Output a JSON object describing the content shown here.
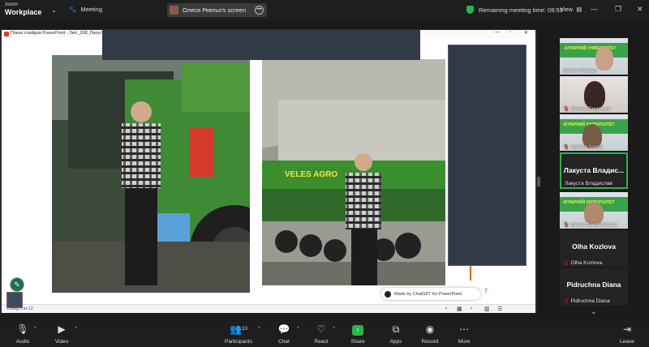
{
  "topbar": {
    "brand_line1": "zoom",
    "brand_line2": "Workplace",
    "meeting_label": "Meeting",
    "share_label": "Олеся Ревтьо's screen",
    "remaining": "Remaining meeting time: 09:53",
    "view_label": "View"
  },
  "ppt": {
    "title": "Показ слайдов PowerPoint - Звіт_208_Лакуста В...",
    "made_with": "Made by ChatGPT for PowerPoint",
    "page_number": "7",
    "status_left": "Слайд 1 из 12"
  },
  "gallery": [
    {
      "name": "Олеся Ревтьо",
      "muted": false,
      "video": true
    },
    {
      "name": "Олена Сидякіна",
      "muted": true,
      "video": true
    },
    {
      "name": "Mykola Ivaniv",
      "muted": true,
      "video": true
    },
    {
      "name": "Лакуста Владислав",
      "big": "Лакуста Владис...",
      "muted": false,
      "video": false,
      "active": true
    },
    {
      "name": "Ірина Соколовська",
      "muted": true,
      "video": true
    },
    {
      "name": "Olha Kozlova",
      "big": "Olha Kozlova",
      "muted": true,
      "video": false
    },
    {
      "name": "Pidruchna Diana",
      "big": "Pidruchna Diana",
      "muted": true,
      "video": false
    }
  ],
  "toolbar": {
    "audio": "Audio",
    "video": "Video",
    "participants": "Participants",
    "participants_count": "10",
    "chat": "Chat",
    "react": "React",
    "share": "Share",
    "apps": "Apps",
    "record": "Record",
    "more": "More",
    "leave": "Leave"
  },
  "colors": {
    "accent_green": "#2fb24c",
    "muted_red": "#e02929",
    "slide_orange": "#e06a20"
  },
  "icons": [
    "chevron-down-icon",
    "meeting-icon",
    "more-icon",
    "shield-icon",
    "minimize-icon",
    "maximize-icon",
    "close-icon",
    "mic-muted-icon",
    "camera-off-icon",
    "participants-icon",
    "chat-icon",
    "react-icon",
    "share-screen-icon",
    "apps-icon",
    "record-icon",
    "more-icon",
    "leave-icon",
    "pen-icon"
  ]
}
